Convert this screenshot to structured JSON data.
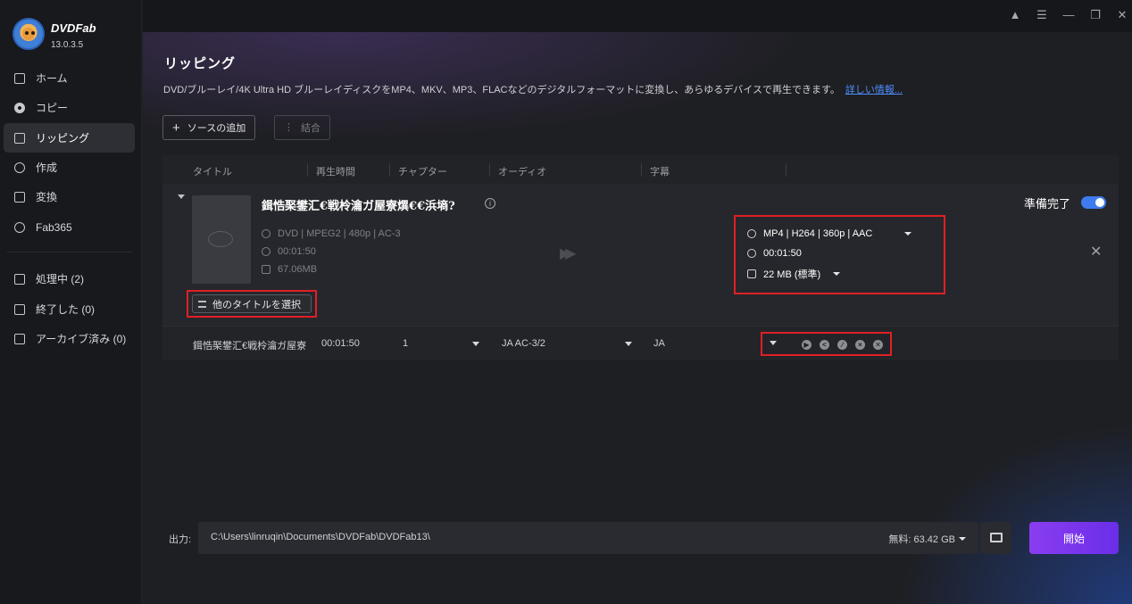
{
  "app": {
    "brand": "DVDFab",
    "version": "13.0.3.5"
  },
  "sidebar": {
    "items": [
      {
        "label": "ホーム",
        "icon": "home-icon"
      },
      {
        "label": "コピー",
        "icon": "copy-disc-icon"
      },
      {
        "label": "リッピング",
        "icon": "ripper-icon",
        "active": true
      },
      {
        "label": "作成",
        "icon": "creator-icon"
      },
      {
        "label": "変換",
        "icon": "converter-icon"
      },
      {
        "label": "Fab365",
        "icon": "fab365-icon"
      }
    ],
    "queue": [
      {
        "label": "処理中 (2)",
        "icon": "processing-icon"
      },
      {
        "label": "終了した (0)",
        "icon": "finished-icon"
      },
      {
        "label": "アーカイブ済み (0)",
        "icon": "archive-icon"
      }
    ]
  },
  "window_controls": [
    "shirt-icon",
    "menu-icon",
    "minimize-icon",
    "restore-icon",
    "close-icon"
  ],
  "main": {
    "title": "リッピング",
    "description": "DVD/ブルーレイ/4K Ultra HD ブルーレイディスクをMP4、MKV、MP3、FLACなどのデジタルフォーマットに変換し、あらゆるデバイスで再生できます。",
    "more_link": "詳しい情報...",
    "add_source": "ソースの追加",
    "merge": "結合",
    "columns": [
      "タイトル",
      "再生時間",
      "チャプター",
      "オーディオ",
      "字幕"
    ],
    "item": {
      "title": "鍓悎棸鐢汇€戦柃瀹ガ屋寮熼€€浜墒?",
      "source_format": "DVD | MPEG2 | 480p | AC-3",
      "source_duration": "00:01:50",
      "source_size": "67.06MB",
      "output_format": "MP4 | H264 | 360p | AAC",
      "output_duration": "00:01:50",
      "output_size": "22 MB (標準)",
      "ready_label": "準備完了",
      "ready": true,
      "select_other": "他のタイトルを選択"
    },
    "sub_row": {
      "title": "鍓悎棸鐢汇€戦柃瀹ガ屋寮",
      "duration": "00:01:50",
      "chapter": "1",
      "audio": "JA  AC-3/2",
      "subtitle": "JA"
    }
  },
  "footer": {
    "output_label": "出力:",
    "path": "C:\\Users\\linruqin\\Documents\\DVDFab\\DVDFab13\\",
    "free_space": "無料:  63.42 GB",
    "start": "開始"
  },
  "colors": {
    "accent": "#3e7bf0",
    "highlight": "#e01f26",
    "start": "#7b35ee"
  }
}
